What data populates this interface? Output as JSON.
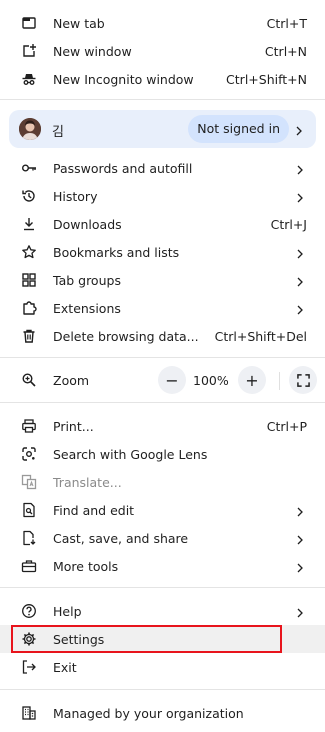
{
  "menu": {
    "new_tab": {
      "label": "New tab",
      "shortcut": "Ctrl+T"
    },
    "new_window": {
      "label": "New window",
      "shortcut": "Ctrl+N"
    },
    "new_incognito": {
      "label": "New Incognito window",
      "shortcut": "Ctrl+Shift+N"
    },
    "profile": {
      "name": "김",
      "status": "Not signed in"
    },
    "passwords": {
      "label": "Passwords and autofill"
    },
    "history": {
      "label": "History"
    },
    "downloads": {
      "label": "Downloads",
      "shortcut": "Ctrl+J"
    },
    "bookmarks": {
      "label": "Bookmarks and lists"
    },
    "tab_groups": {
      "label": "Tab groups"
    },
    "extensions": {
      "label": "Extensions"
    },
    "delete_data": {
      "label": "Delete browsing data...",
      "shortcut": "Ctrl+Shift+Del"
    },
    "zoom": {
      "label": "Zoom",
      "minus": "−",
      "value": "100%",
      "plus": "+"
    },
    "print": {
      "label": "Print...",
      "shortcut": "Ctrl+P"
    },
    "google_lens": {
      "label": "Search with Google Lens"
    },
    "translate": {
      "label": "Translate..."
    },
    "find_edit": {
      "label": "Find and edit"
    },
    "cast_save_share": {
      "label": "Cast, save, and share"
    },
    "more_tools": {
      "label": "More tools"
    },
    "help": {
      "label": "Help"
    },
    "settings": {
      "label": "Settings"
    },
    "exit": {
      "label": "Exit"
    },
    "managed": {
      "label": "Managed by your organization"
    }
  },
  "colors": {
    "highlight_border": "#e8141c",
    "profile_bg": "#e8effb",
    "pill_bg": "#d3e3fd"
  }
}
